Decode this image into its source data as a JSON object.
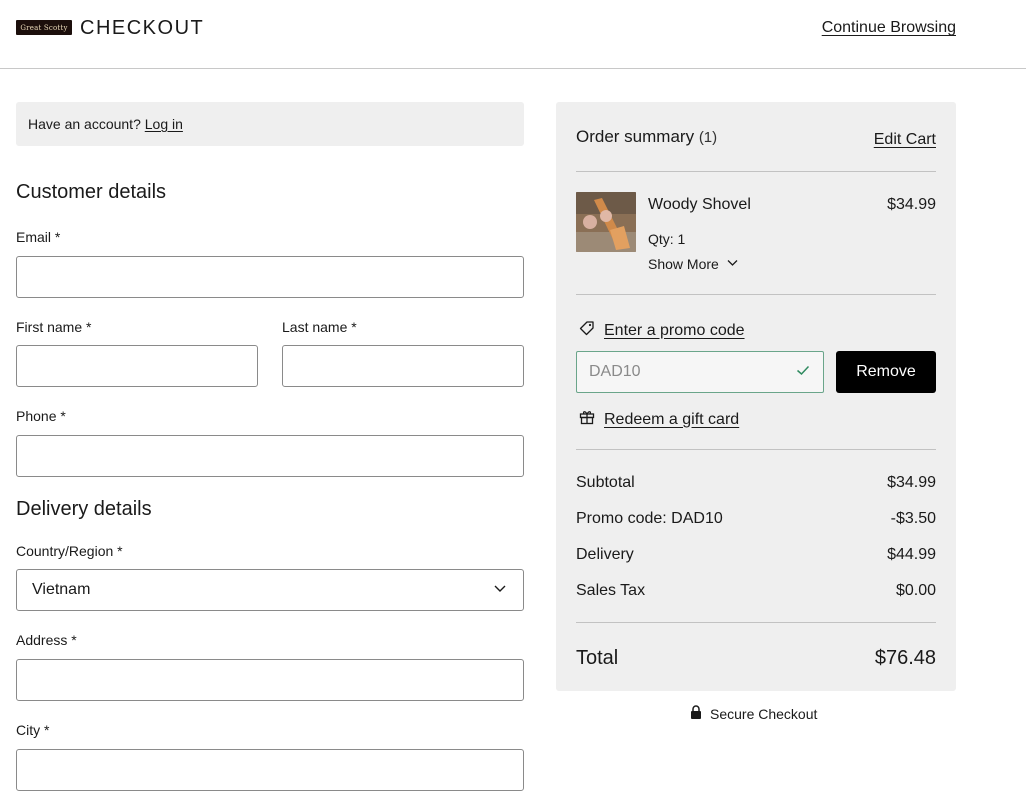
{
  "header": {
    "logo_text": "Great Scotty",
    "title": "CHECKOUT",
    "continue_label": "Continue Browsing"
  },
  "account": {
    "prompt": "Have an account?",
    "login_label": "Log in"
  },
  "customer": {
    "title": "Customer details",
    "email_label": "Email *",
    "email_value": "",
    "first_name_label": "First name *",
    "first_name_value": "",
    "last_name_label": "Last name *",
    "last_name_value": "",
    "phone_label": "Phone *",
    "phone_value": ""
  },
  "delivery": {
    "title": "Delivery details",
    "country_label": "Country/Region *",
    "country_value": "Vietnam",
    "address_label": "Address *",
    "address_value": "",
    "city_label": "City *",
    "city_value": ""
  },
  "summary": {
    "title": "Order summary",
    "count": "(1)",
    "edit_cart_label": "Edit Cart",
    "item": {
      "name": "Woody Shovel",
      "price": "$34.99",
      "qty": "Qty: 1",
      "show_more_label": "Show More"
    },
    "promo_link_label": "Enter a promo code",
    "promo_code_value": "DAD10",
    "remove_label": "Remove",
    "gift_link_label": "Redeem a gift card",
    "rows": {
      "subtotal_label": "Subtotal",
      "subtotal_value": "$34.99",
      "promo_label": "Promo code: DAD10",
      "promo_value": "-$3.50",
      "delivery_label": "Delivery",
      "delivery_value": "$44.99",
      "tax_label": "Sales Tax",
      "tax_value": "$0.00"
    },
    "total_label": "Total",
    "total_value": "$76.48"
  },
  "secure_label": "Secure Checkout",
  "colors": {
    "summary_bg": "#efefef",
    "button_bg": "#000000",
    "promo_valid_border": "#6aa58a",
    "check_color": "#2f8a5f"
  },
  "icons": {
    "promo": "tag-icon",
    "gift": "gift-icon",
    "valid": "checkmark-icon",
    "dropdown": "chevron-down-icon",
    "secure": "lock-icon"
  }
}
